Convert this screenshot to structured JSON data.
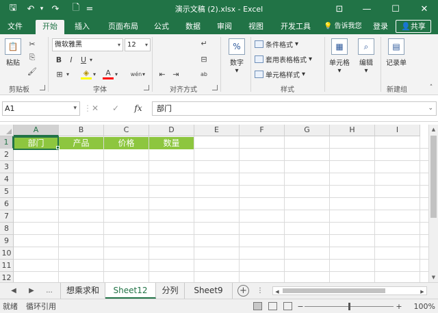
{
  "window": {
    "title": "演示文稿 (2).xlsx - Excel",
    "qat": {
      "save": "🖫",
      "undo": "↶",
      "undo_dd": "▾",
      "new": "🗋",
      "customize": "="
    },
    "controls": {
      "ribbon_opts": "⊡",
      "minimize": "—",
      "maximize": "☐",
      "close": "✕"
    }
  },
  "tabs": [
    {
      "label": "文件"
    },
    {
      "label": "开始"
    },
    {
      "label": "插入"
    },
    {
      "label": "页面布局"
    },
    {
      "label": "公式"
    },
    {
      "label": "数据"
    },
    {
      "label": "审阅"
    },
    {
      "label": "视图"
    },
    {
      "label": "开发工具"
    }
  ],
  "tell_me": "告诉我您",
  "tell_me_icon": "💡",
  "login": "登录",
  "share": "共享",
  "ribbon": {
    "clipboard": {
      "paste": "粘贴",
      "paste_icon": "📋",
      "cut": "✂",
      "copy": "⎘",
      "format_painter": "🖌",
      "label": "剪贴板"
    },
    "font": {
      "font_name": "微软雅黑",
      "font_size": "12",
      "grow": "A",
      "shrink": "A",
      "bold": "B",
      "italic": "I",
      "underline": "U",
      "underline_dd": "▾",
      "border": "⊞",
      "border_dd": "▾",
      "fill": "◈",
      "fill_dd": "▾",
      "font_color": "A",
      "font_color_dd": "▾",
      "phonetic": "wén",
      "phonetic_dd": "▾",
      "label": "字体"
    },
    "alignment": {
      "wrap": "↵",
      "merge": "⊟",
      "indent_dec": "⇤",
      "indent_inc": "⇥",
      "orient": "ab",
      "label": "对齐方式"
    },
    "number": {
      "label": "数字",
      "symbol": "%",
      "dd": "▾"
    },
    "styles": {
      "conditional": "条件格式",
      "table": "套用表格格式",
      "cell": "单元格样式",
      "dd": "▾",
      "label": "样式"
    },
    "cells": {
      "label": "单元格",
      "icon": "▦",
      "dd": "▾"
    },
    "editing": {
      "label": "编辑",
      "icon": "⌕",
      "dd": "▾"
    },
    "new_group": {
      "record": "记录单",
      "icon": "▤",
      "label": "新建组"
    }
  },
  "formula_bar": {
    "name_box": "A1",
    "name_dd": "▾",
    "cancel": "✕",
    "enter": "✓",
    "fx": "fx",
    "value": "部门",
    "expand": "⌄"
  },
  "grid": {
    "columns": [
      "A",
      "B",
      "C",
      "D",
      "E",
      "F",
      "G",
      "H",
      "I"
    ],
    "rows": [
      "1",
      "2",
      "3",
      "4",
      "5",
      "6",
      "7",
      "8",
      "9",
      "10",
      "11",
      "12"
    ],
    "header_cells": [
      "部门",
      "产品",
      "价格",
      "数量"
    ],
    "header_fill": "#8dc63f",
    "active_cell": "A1"
  },
  "scroll": {
    "up": "▲",
    "down": "▼",
    "left": "◀",
    "right": "▶"
  },
  "sheets": {
    "nav_prev": "◀",
    "nav_next": "▶",
    "nav_more": "...",
    "tabs": [
      {
        "label": "想乘求和"
      },
      {
        "label": "Sheet12"
      },
      {
        "label": "分列"
      },
      {
        "label": "Sheet9"
      }
    ],
    "active": "Sheet12",
    "add": "+",
    "more": "⋮"
  },
  "status": {
    "ready": "就绪",
    "circular": "循环引用",
    "view_normal": "",
    "zoom_out": "−",
    "zoom_in": "+",
    "zoom": "100%",
    "zoom_level_pct": 100
  },
  "colors": {
    "brand": "#217346",
    "header_fill": "#8dc63f"
  }
}
